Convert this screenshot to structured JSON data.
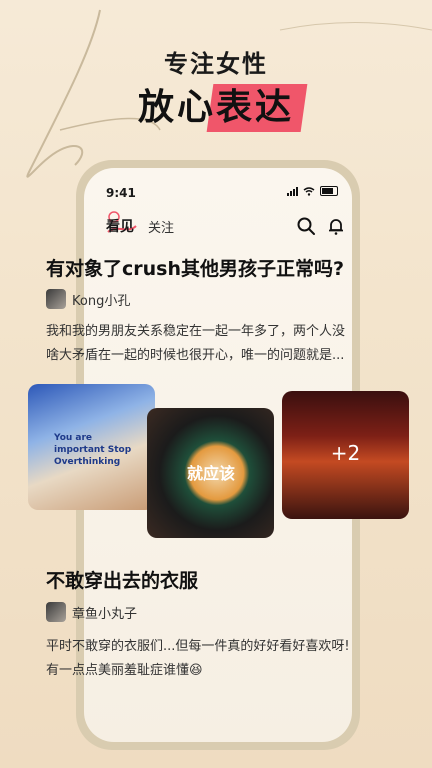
{
  "promo": {
    "subtitle": "专注女性",
    "title_prefix": "放心",
    "title_highlight": "表达"
  },
  "status_bar": {
    "time": "9:41"
  },
  "tabs": {
    "active": "看见",
    "inactive": "关注"
  },
  "posts": [
    {
      "title": "有对象了crush其他男孩子正常吗?",
      "author": "Kong小孔",
      "excerpt_line1": "我和我的男朋友关系稳定在一起一年多了，两个人没",
      "excerpt_line2": "啥大矛盾在一起的时候也很开心，唯一的问题就是...",
      "more_images": "+2",
      "image1_text": "You are important Stop Overthinking",
      "image2_text": "就应该"
    },
    {
      "title": "不敢穿出去的衣服",
      "author": "章鱼小丸子",
      "excerpt_line1": "平时不敢穿的衣服们...但每一件真的好好看好喜欢呀!",
      "excerpt_line2": "有一点点美丽羞耻症谁懂😆"
    }
  ],
  "icons": {
    "search": "search-icon",
    "notification": "bell-icon"
  },
  "colors": {
    "highlight": "#f0566a",
    "background": "#f3e4cc"
  }
}
